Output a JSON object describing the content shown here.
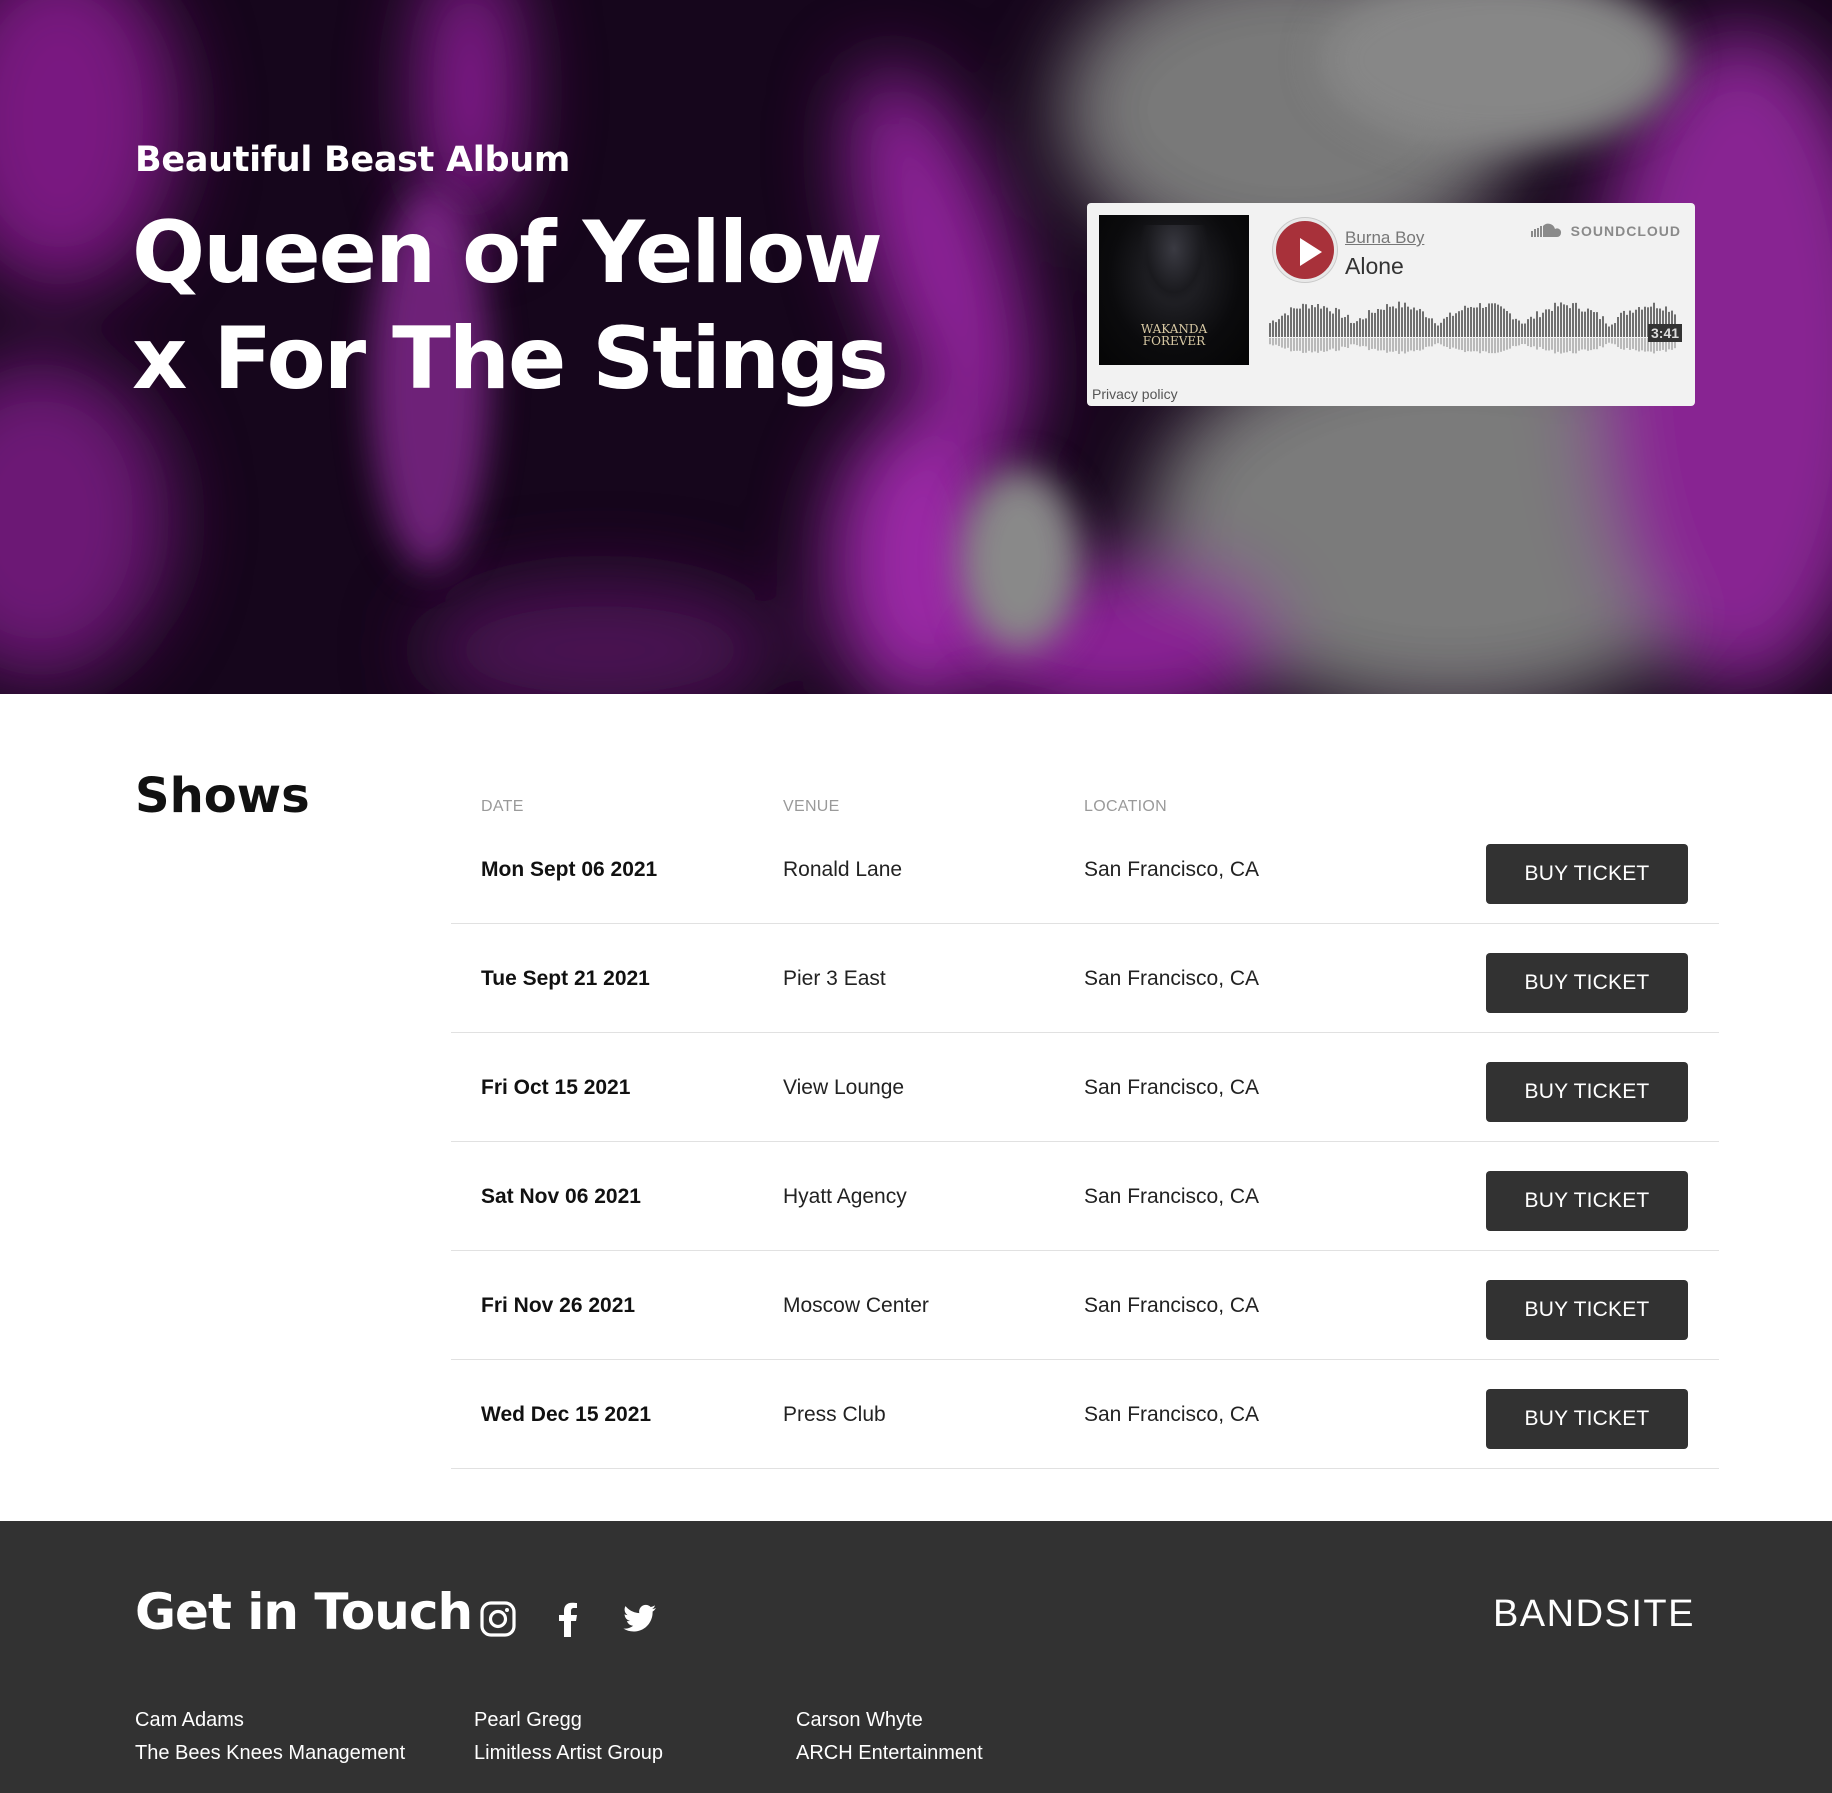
{
  "hero": {
    "subtitle": "Beautiful Beast Album",
    "title_line1": "Queen of Yellow",
    "title_line2": "x For The Stings"
  },
  "player": {
    "artist": "Burna Boy",
    "track": "Alone",
    "brand": "SOUNDCLOUD",
    "duration": "3:41",
    "privacy": "Privacy policy",
    "artwork_text_line1": "WAKANDA",
    "artwork_text_line2": "FOREVER",
    "accent_color": "#a8313a"
  },
  "shows": {
    "heading": "Shows",
    "columns": {
      "date": "DATE",
      "venue": "VENUE",
      "location": "LOCATION"
    },
    "rows": [
      {
        "date": "Mon Sept 06 2021",
        "venue": "Ronald Lane",
        "location": "San Francisco, CA",
        "button": "BUY TICKET"
      },
      {
        "date": "Tue Sept 21 2021",
        "venue": "Pier 3 East",
        "location": "San Francisco, CA",
        "button": "BUY TICKET"
      },
      {
        "date": "Fri Oct 15 2021",
        "venue": "View Lounge",
        "location": "San Francisco, CA",
        "button": "BUY TICKET"
      },
      {
        "date": "Sat Nov 06 2021",
        "venue": "Hyatt Agency",
        "location": "San Francisco, CA",
        "button": "BUY TICKET"
      },
      {
        "date": "Fri Nov 26 2021",
        "venue": "Moscow Center",
        "location": "San Francisco, CA",
        "button": "BUY TICKET"
      },
      {
        "date": "Wed Dec 15 2021",
        "venue": "Press Club",
        "location": "San Francisco, CA",
        "button": "BUY TICKET"
      }
    ]
  },
  "footer": {
    "title": "Get in Touch",
    "social_icons": [
      "instagram-icon",
      "facebook-icon",
      "twitter-icon"
    ],
    "brand": "BANDSITE",
    "contacts": [
      {
        "name": "Cam Adams",
        "company": "The Bees Knees Management"
      },
      {
        "name": "Pearl Gregg",
        "company": "Limitless Artist Group"
      },
      {
        "name": "Carson Whyte",
        "company": "ARCH Entertainment"
      }
    ],
    "background_color": "#323232"
  }
}
